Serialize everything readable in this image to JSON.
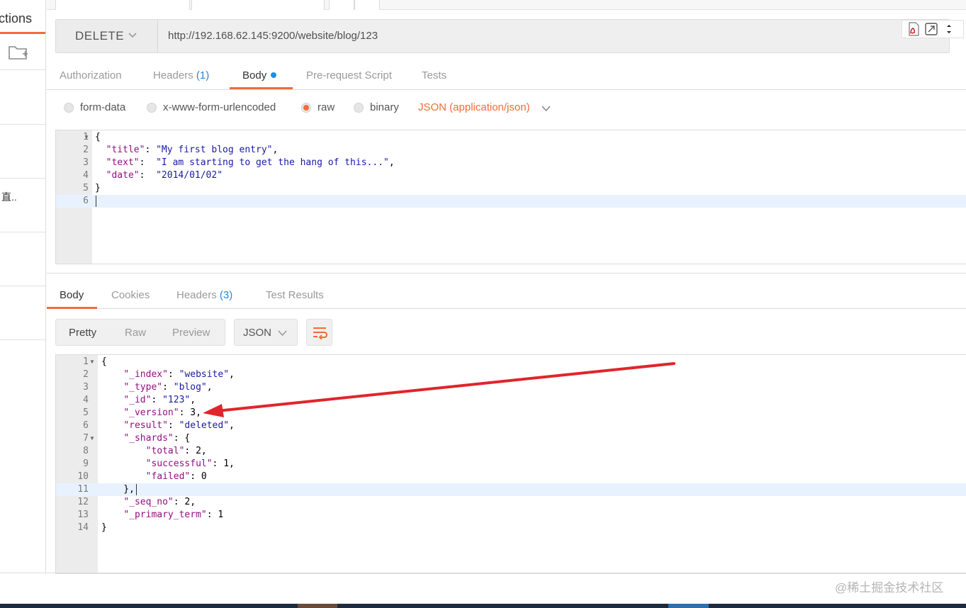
{
  "sidebar": {
    "title_fragment": "ctions",
    "cut_text": "直..",
    "folder_icon": "new-folder-icon"
  },
  "request": {
    "method": "DELETE",
    "url": "http://192.168.62.145:9200/website/blog/123",
    "tabs": [
      {
        "label": "Authorization"
      },
      {
        "label": "Headers",
        "count": "(1)"
      },
      {
        "label": "Body"
      },
      {
        "label": "Pre-request Script"
      },
      {
        "label": "Tests"
      }
    ],
    "body_types": [
      {
        "label": "form-data",
        "selected": false
      },
      {
        "label": "x-www-form-urlencoded",
        "selected": false
      },
      {
        "label": "raw",
        "selected": true
      },
      {
        "label": "binary",
        "selected": false
      }
    ],
    "content_type": "JSON (application/json)",
    "line_numbers": [
      "1",
      "2",
      "3",
      "4",
      "5",
      "6"
    ],
    "body_lines": [
      "{",
      "  \"title\": \"My first blog entry\",",
      "  \"text\":  \"I am starting to get the hang of this...\",",
      "  \"date\":  \"2014/01/02\"",
      "}",
      ""
    ]
  },
  "response": {
    "tabs": [
      {
        "label": "Body"
      },
      {
        "label": "Cookies"
      },
      {
        "label": "Headers",
        "count": "(3)"
      },
      {
        "label": "Test Results"
      }
    ],
    "views": [
      "Pretty",
      "Raw",
      "Preview"
    ],
    "format": "JSON",
    "line_numbers": [
      "1",
      "2",
      "3",
      "4",
      "5",
      "6",
      "7",
      "8",
      "9",
      "10",
      "11",
      "12",
      "13",
      "14"
    ],
    "body_lines": [
      "{",
      "    \"_index\": \"website\",",
      "    \"_type\": \"blog\",",
      "    \"_id\": \"123\",",
      "    \"_version\": 3,",
      "    \"result\": \"deleted\",",
      "    \"_shards\": {",
      "        \"total\": 2,",
      "        \"successful\": 1,",
      "        \"failed\": 0",
      "    },",
      "    \"_seq_no\": 2,",
      "    \"_primary_term\": 1",
      "}"
    ]
  },
  "watermark": "@稀土掘金技术社区",
  "colors": {
    "accent": "#f26b3a",
    "link_count": "#2a86d6",
    "annotation_arrow": "#e0252b"
  }
}
